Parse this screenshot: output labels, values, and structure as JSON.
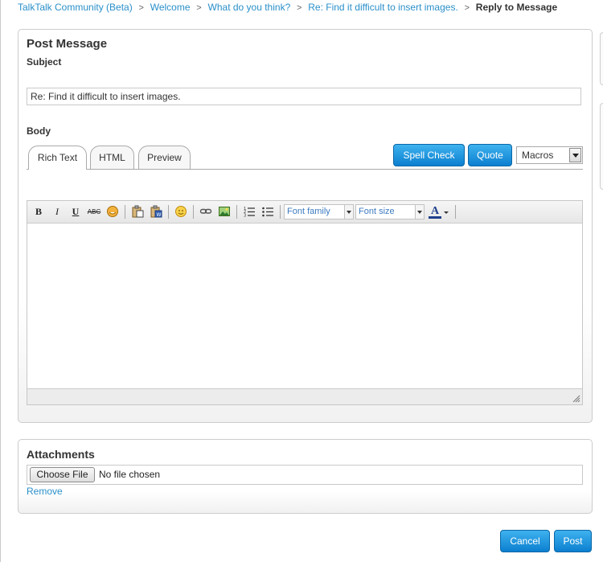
{
  "breadcrumb": {
    "items": [
      "TalkTalk Community (Beta)",
      "Welcome",
      "What do you think?",
      "Re: Find it difficult to insert images."
    ],
    "current": "Reply to Message"
  },
  "post": {
    "title": "Post Message",
    "subject_label": "Subject",
    "subject_value": "Re: Find it difficult to insert images.",
    "body_label": "Body",
    "tabs": [
      {
        "label": "Rich Text",
        "active": true
      },
      {
        "label": "HTML",
        "active": false
      },
      {
        "label": "Preview",
        "active": false
      }
    ],
    "spell_check_label": "Spell Check",
    "quote_label": "Quote",
    "macros_value": "Macros"
  },
  "editor": {
    "toolbar": {
      "bold": "B",
      "italic": "I",
      "underline": "U",
      "strikethrough": "ABC",
      "font_family_placeholder": "Font family",
      "font_size_placeholder": "Font size",
      "text_color": "A"
    }
  },
  "attachments": {
    "title": "Attachments",
    "choose_file_label": "Choose File",
    "file_status": "No file chosen",
    "remove_label": "Remove"
  },
  "footer": {
    "cancel_label": "Cancel",
    "post_label": "Post"
  },
  "colors": {
    "link": "#2a8fc9",
    "button_top": "#3fb2ef",
    "button_bottom": "#0b7fcf"
  }
}
